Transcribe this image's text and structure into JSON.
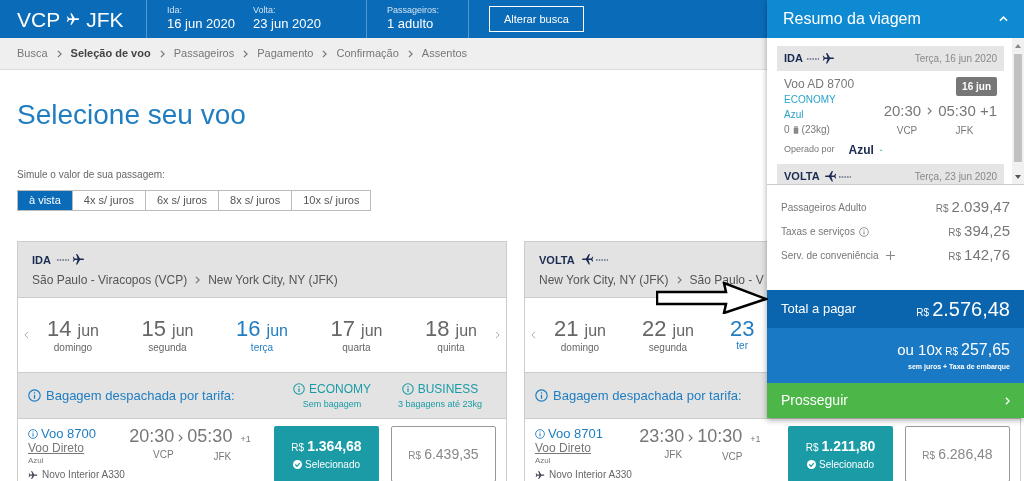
{
  "header": {
    "route_from": "VCP",
    "route_to": "JFK",
    "fields": [
      {
        "label": "Ida:",
        "value": "16 jun 2020"
      },
      {
        "label": "Volta:",
        "value": "23 jun 2020"
      },
      {
        "label": "Passageiros:",
        "value": "1 adulto"
      }
    ],
    "button": "Alterar busca"
  },
  "breadcrumb": [
    {
      "label": "Busca",
      "selected": false
    },
    {
      "label": "Seleção de voo",
      "selected": true
    },
    {
      "label": "Passageiros",
      "selected": false
    },
    {
      "label": "Pagamento",
      "selected": false
    },
    {
      "label": "Confirmação",
      "selected": false
    },
    {
      "label": "Assentos",
      "selected": false
    }
  ],
  "title": "Selecione seu voo",
  "simulate": {
    "label": "Simule o valor de sua passagem:",
    "options": [
      {
        "label": "à vista",
        "selected": true
      },
      {
        "label": "4x s/ juros",
        "selected": false
      },
      {
        "label": "6x s/ juros",
        "selected": false
      },
      {
        "label": "8x s/ juros",
        "selected": false
      },
      {
        "label": "10x s/ juros",
        "selected": false
      }
    ]
  },
  "legs": [
    {
      "kind": "outbound",
      "label": "IDA",
      "route_from": "São Paulo - Viracopos (VCP)",
      "route_to": "New York City, NY (JFK)",
      "dates": [
        {
          "day": "14",
          "month": "jun",
          "weekday": "domingo",
          "selected": false
        },
        {
          "day": "15",
          "month": "jun",
          "weekday": "segunda",
          "selected": false
        },
        {
          "day": "16",
          "month": "jun",
          "weekday": "terça",
          "selected": true
        },
        {
          "day": "17",
          "month": "jun",
          "weekday": "quarta",
          "selected": false
        },
        {
          "day": "18",
          "month": "jun",
          "weekday": "quinta",
          "selected": false
        }
      ],
      "baggage_label": "Bagagem despachada por tarifa:",
      "fare_classes": [
        {
          "name": "ECONOMY",
          "note": "Sem bagagem"
        },
        {
          "name": "BUSINESS",
          "note": "3 bagagens até 23kg"
        }
      ],
      "flights": [
        {
          "number": "Voo 8700",
          "type": "Voo Direto",
          "airline": "Azul",
          "depart": "20:30",
          "arrive": "05:30",
          "day_offset": "+1",
          "from": "VCP",
          "to": "JFK",
          "aircraft": "Novo Interior A330",
          "fares": [
            {
              "currency": "R$",
              "amount": "1.364,68",
              "selected": true,
              "status": "Selecionado"
            },
            {
              "currency": "R$",
              "amount": "6.439,35",
              "selected": false
            }
          ]
        }
      ]
    },
    {
      "kind": "return",
      "label": "VOLTA",
      "route_from": "New York City, NY (JFK)",
      "route_to": "São Paulo - V",
      "dates": [
        {
          "day": "21",
          "month": "jun",
          "weekday": "domingo",
          "selected": false
        },
        {
          "day": "22",
          "month": "jun",
          "weekday": "segunda",
          "selected": false
        },
        {
          "day": "23",
          "weekday": "ter",
          "selected": true
        }
      ],
      "baggage_label": "Bagagem despachada por tarifa:",
      "flights": [
        {
          "number": "Voo 8701",
          "type": "Voo Direto",
          "airline": "Azul",
          "depart": "23:30",
          "arrive": "10:30",
          "day_offset": "+1",
          "from": "JFK",
          "to": "VCP",
          "aircraft": "Novo Interior A330",
          "fares": [
            {
              "currency": "R$",
              "amount": "1.211,80",
              "selected": true,
              "status": "Selecionado"
            },
            {
              "currency": "R$",
              "amount": "6.286,48",
              "selected": false
            }
          ]
        }
      ]
    }
  ],
  "summary": {
    "title": "Resumo da viagem",
    "legs": [
      {
        "kind": "outbound",
        "label": "IDA",
        "date": "Terça, 16 jun 2020",
        "flight": "Voo AD 8700",
        "fare_class": "ECONOMY",
        "airline": "Azul",
        "bags": "0",
        "bag_weight": "(23kg)",
        "date_badge": "16 jun",
        "depart": "20:30",
        "arrive": "05:30 +1",
        "from": "VCP",
        "to": "JFK",
        "operated_label": "Operado por",
        "operator": "Azul"
      },
      {
        "kind": "return",
        "label": "VOLTA",
        "date": "Terça, 23 jun 2020"
      }
    ],
    "charges": [
      {
        "kind": "plain",
        "label": "Passageiros Adulto",
        "currency": "R$",
        "amount": "2.039,47"
      },
      {
        "kind": "info",
        "label": "Taxas e serviços",
        "currency": "R$",
        "amount": "394,25"
      },
      {
        "kind": "expandable",
        "label": "Serv. de conveniência",
        "currency": "R$",
        "amount": "142,76"
      }
    ],
    "total": {
      "label": "Total a pagar",
      "currency": "R$",
      "amount": "2.576,48"
    },
    "installment": {
      "prefix": "ou 10x",
      "currency": "R$",
      "amount": "257,65",
      "note": "sem juros + Taxa de embarque"
    },
    "proceed": "Prosseguir"
  }
}
